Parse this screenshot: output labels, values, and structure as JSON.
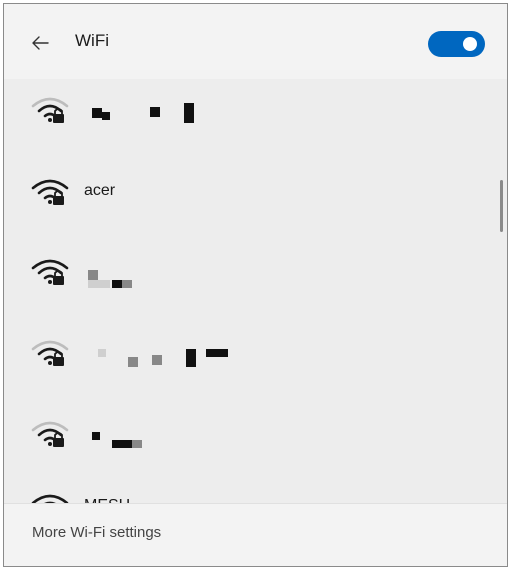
{
  "header": {
    "title": "WiFi",
    "back_icon": "back-arrow-icon",
    "toggle_state": "on",
    "accent": "#0067c0"
  },
  "networks": [
    {
      "name": "",
      "secured": true,
      "redacted": true
    },
    {
      "name": "acer",
      "secured": true,
      "redacted": false
    },
    {
      "name": "",
      "secured": true,
      "redacted": true
    },
    {
      "name": "",
      "secured": true,
      "redacted": true
    },
    {
      "name": "",
      "secured": true,
      "redacted": true
    },
    {
      "name": "MESH",
      "secured": false,
      "redacted": false,
      "partially_visible": true
    }
  ],
  "footer": {
    "more_settings_label": "More Wi-Fi settings"
  }
}
